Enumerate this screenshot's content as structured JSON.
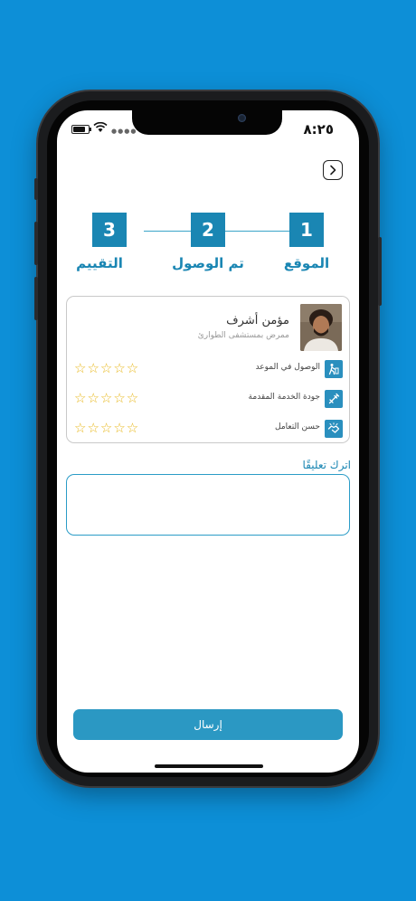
{
  "status_bar": {
    "time": "٨:٢٥"
  },
  "steps": [
    {
      "number": "1",
      "label": "الموقع"
    },
    {
      "number": "2",
      "label": "تم الوصول"
    },
    {
      "number": "3",
      "label": "التقييم"
    }
  ],
  "provider": {
    "name": "مؤمن أشرف",
    "subtitle": "ممرض بمستشفى الطوارئ"
  },
  "ratings": [
    {
      "label": "الوصول في الموعد",
      "icon": "walking-person-icon",
      "stars": "☆☆☆☆☆"
    },
    {
      "label": "جودة الخدمة المقدمة",
      "icon": "syringe-icon",
      "stars": "☆☆☆☆☆"
    },
    {
      "label": "حسن التعامل",
      "icon": "handshake-icon",
      "stars": "☆☆☆☆☆"
    }
  ],
  "comment": {
    "label": "اترك تعليقًا",
    "value": ""
  },
  "submit": {
    "label": "إرسال"
  },
  "colors": {
    "primary": "#1a86b3",
    "background": "#0d8fd7",
    "star": "#e8b81c"
  }
}
